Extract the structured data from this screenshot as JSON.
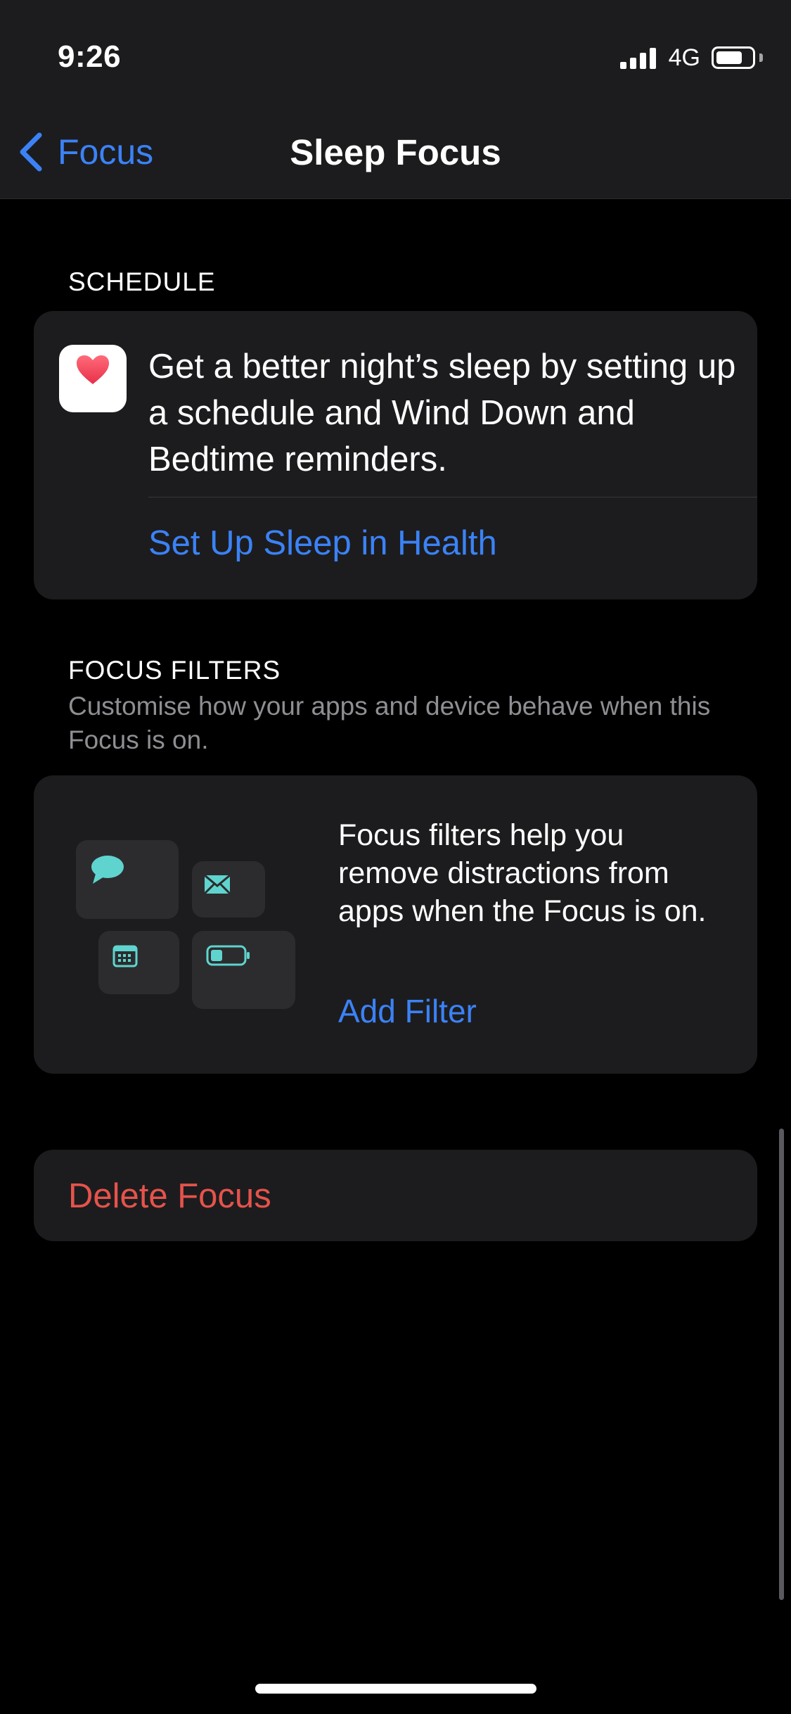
{
  "status_bar": {
    "time": "9:26",
    "network": "4G",
    "signal_icon": "cellular-signal-icon",
    "battery_icon": "battery-icon"
  },
  "nav": {
    "back_label": "Focus",
    "back_icon": "chevron-left-icon",
    "title": "Sleep Focus"
  },
  "schedule": {
    "header": "SCHEDULE",
    "icon": "health-heart-icon",
    "description": "Get a better night’s sleep by setting up a schedule and Wind Down and Bedtime reminders.",
    "link": "Set Up Sleep in Health"
  },
  "focus_filters": {
    "header": "FOCUS FILTERS",
    "subtitle": "Customise how your apps and device behave when this Focus is on.",
    "illustration_icons": [
      "message-bubble-icon",
      "mail-icon",
      "calendar-icon",
      "battery-icon"
    ],
    "description": "Focus filters help you remove distractions from apps when the Focus is on.",
    "add_label": "Add Filter"
  },
  "delete": {
    "label": "Delete Focus"
  },
  "colors": {
    "accent": "#3b82f6",
    "destructive": "#e5534b",
    "icon_tint": "#5fd4cf",
    "card": "#1c1c1e"
  }
}
